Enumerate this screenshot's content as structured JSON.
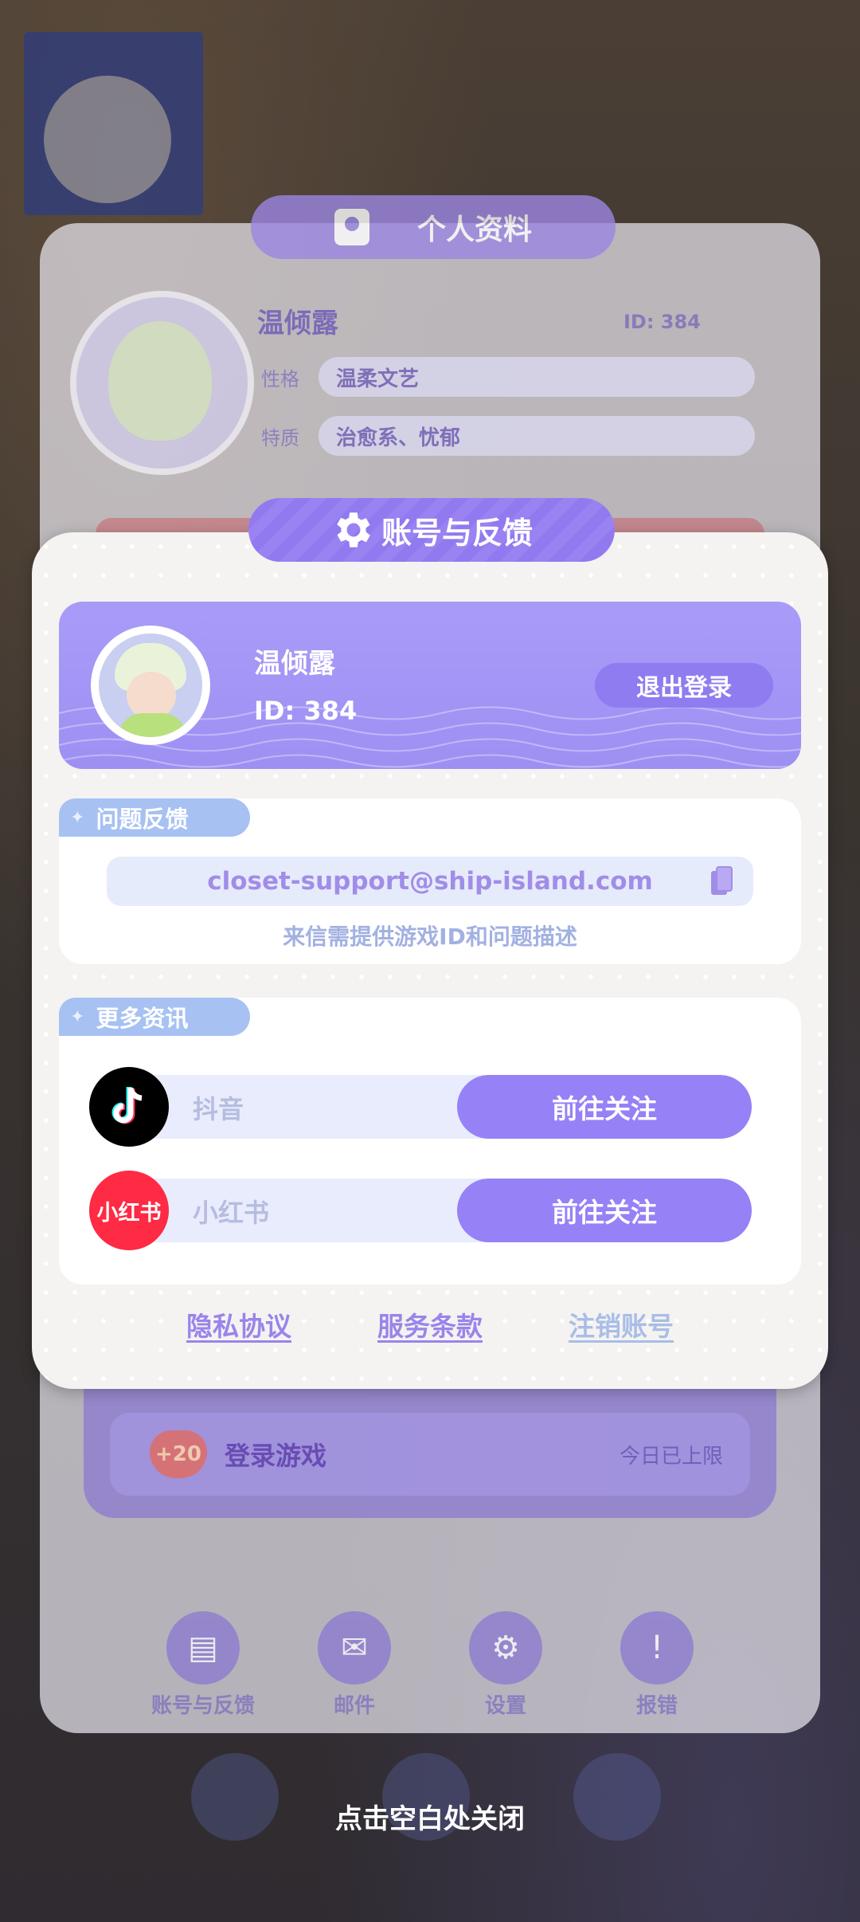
{
  "background_profile": {
    "title": "个人资料",
    "name": "温倾露",
    "id_label": "ID: 384",
    "traits": [
      {
        "key": "性格",
        "value": "温柔文艺"
      },
      {
        "key": "特质",
        "value": "治愈系、忧郁"
      }
    ],
    "task": {
      "reward": "+20",
      "name": "登录游戏",
      "status": "今日已上限"
    },
    "nav": [
      {
        "label": "账号与反馈",
        "icon": "id-card-icon"
      },
      {
        "label": "邮件",
        "icon": "mail-icon"
      },
      {
        "label": "设置",
        "icon": "gear-icon"
      },
      {
        "label": "报错",
        "icon": "report-icon"
      }
    ]
  },
  "modal": {
    "title": "账号与反馈",
    "account": {
      "name": "温倾露",
      "id": "ID: 384",
      "logout": "退出登录"
    },
    "feedback": {
      "label": "问题反馈",
      "email": "closet-support@ship-island.com",
      "hint": "来信需提供游戏ID和问题描述"
    },
    "more": {
      "label": "更多资讯",
      "items": [
        {
          "name": "抖音",
          "logo": "tiktok-logo",
          "button": "前往关注"
        },
        {
          "name": "小红书",
          "logo_text": "小红书",
          "button": "前往关注"
        }
      ]
    },
    "links": {
      "privacy": "隐私协议",
      "terms": "服务条款",
      "cancel": "注销账号"
    }
  },
  "close_hint": "点击空白处关闭",
  "colors": {
    "accent": "#9681f6",
    "card": "#a89bf8",
    "label": "#a6c1f2",
    "xhs_red": "#ff2a43"
  }
}
